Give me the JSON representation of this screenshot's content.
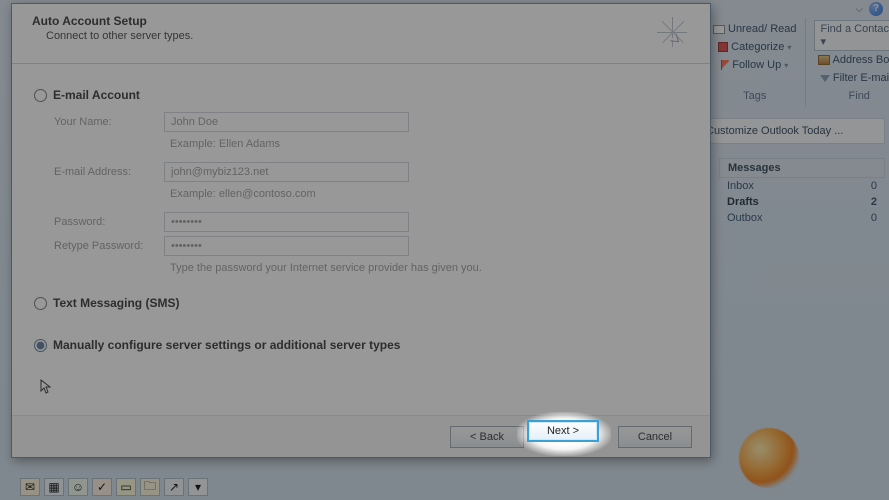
{
  "ribbon": {
    "unread_read": "Unread/ Read",
    "categorize": "Categorize",
    "follow_up": "Follow Up",
    "tags_group": "Tags",
    "find_contact": "Find a Contact",
    "address_book": "Address Book",
    "filter_email": "Filter E-mail",
    "find_group": "Find"
  },
  "right_panel": {
    "customize": "Customize Outlook Today ...",
    "messages_header": "Messages",
    "rows": [
      {
        "label": "Inbox",
        "count": "0",
        "bold": false
      },
      {
        "label": "Drafts",
        "count": "2",
        "bold": true
      },
      {
        "label": "Outbox",
        "count": "0",
        "bold": false
      }
    ]
  },
  "dialog": {
    "title": "Auto Account Setup",
    "subtitle": "Connect to other server types.",
    "opt_email": "E-mail Account",
    "opt_sms": "Text Messaging (SMS)",
    "opt_manual": "Manually configure server settings or additional server types",
    "labels": {
      "your_name": "Your Name:",
      "email": "E-mail Address:",
      "password": "Password:",
      "retype": "Retype Password:"
    },
    "values": {
      "your_name": "John Doe",
      "email": "john@mybiz123.net",
      "password": "********",
      "retype": "********"
    },
    "hints": {
      "name_example": "Example: Ellen Adams",
      "email_example": "Example: ellen@contoso.com",
      "password_hint": "Type the password your Internet service provider has given you."
    },
    "buttons": {
      "back": "< Back",
      "next": "Next >",
      "cancel": "Cancel"
    }
  }
}
